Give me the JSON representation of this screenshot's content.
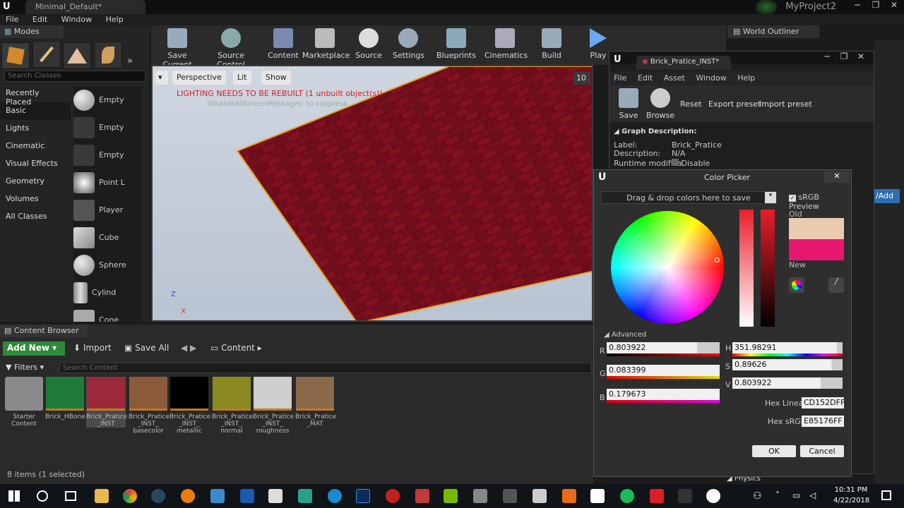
{
  "window": {
    "tab": "Minimal_Default*",
    "project": "MyProject2"
  },
  "menubar": [
    "File",
    "Edit",
    "Window",
    "Help"
  ],
  "modes": {
    "title": "Modes",
    "search_placeholder": "Search Classes",
    "categories": [
      "Recently Placed",
      "Basic",
      "Lights",
      "Cinematic",
      "Visual Effects",
      "Geometry",
      "Volumes",
      "All Classes"
    ],
    "items": [
      "Empty",
      "Empty",
      "Empty",
      "Point L",
      "Player",
      "Cube",
      "Sphere",
      "Cylind",
      "Cone"
    ]
  },
  "toolbar": [
    "Save Current",
    "Source Control",
    "Content",
    "Marketplace",
    "Source",
    "Settings",
    "Blueprints",
    "Cinematics",
    "Build",
    "Play"
  ],
  "viewport": {
    "perspective": "Perspective",
    "lit": "Lit",
    "show": "Show",
    "warning": "LIGHTING NEEDS TO BE REBUILT (1 unbuilt object(s))",
    "hint": "'DisableAllScreenMessages' to suppress",
    "grid": "10",
    "axis_z": "Z",
    "axis_x": "X"
  },
  "world_outliner": {
    "title": "World Outliner"
  },
  "content_browser": {
    "title": "Content Browser",
    "add_new": "Add New",
    "import": "Import",
    "save_all": "Save All",
    "path": "Content",
    "filters": "Filters",
    "search_placeholder": "Search Content",
    "status": "8 items (1 selected)",
    "assets": [
      {
        "name": "Starter Content",
        "color": "#8a8a8a"
      },
      {
        "name": "Brick_HBone",
        "color": "#1e7b3a"
      },
      {
        "name": "Brick_Pratice _INST",
        "color": "#9b2a3a"
      },
      {
        "name": "Brick_Pratice _INST_ basecolor",
        "color": "#8a5a3a"
      },
      {
        "name": "Brick_Pratice _INST_ metallic",
        "color": "#000000"
      },
      {
        "name": "Brick_Pratice _INST_ normal",
        "color": "#8a8a20"
      },
      {
        "name": "Brick_Pratice _INST_ roughness",
        "color": "#cfcfcf"
      },
      {
        "name": "Brick_Pratice _MAT",
        "color": "#8a6a4a"
      }
    ]
  },
  "material_editor": {
    "tab": "Brick_Pratice_INST*",
    "menu": [
      "File",
      "Edit",
      "Asset",
      "Window",
      "Help"
    ],
    "save": "Save",
    "browse": "Browse",
    "reset": "Reset",
    "export": "Export preset",
    "import": "Import preset",
    "graph_title": "Graph Description:",
    "label_key": "Label:",
    "label_val": "Brick_Pratice",
    "desc_key": "Description:",
    "desc_val": "N/A",
    "runtime_key": "Runtime modifica",
    "runtime_val": "Disable",
    "physics": "Physics"
  },
  "color_picker": {
    "title": "Color Picker",
    "drop": "Drag & drop colors here to save",
    "srgb": "sRGB Preview",
    "old": "Old",
    "new": "New",
    "old_color": "#EBCBB0",
    "new_color": "#E5176F",
    "advanced": "Advanced",
    "r_label": "R",
    "r": "0.803922",
    "g_label": "G",
    "g": "0.083399",
    "b_label": "B",
    "b": "0.179673",
    "h_label": "H",
    "h": "351.98291",
    "s_label": "S",
    "s": "0.89626",
    "v_label": "V",
    "v": "0.803922",
    "hex_linear_label": "Hex Linear",
    "hex_linear": "CD152DFF",
    "hex_srgb_label": "Hex sRGB",
    "hex_srgb": "E85176FF",
    "ok": "OK",
    "cancel": "Cancel"
  },
  "taskbar": {
    "time": "10:31 PM",
    "date": "4/22/2018"
  }
}
